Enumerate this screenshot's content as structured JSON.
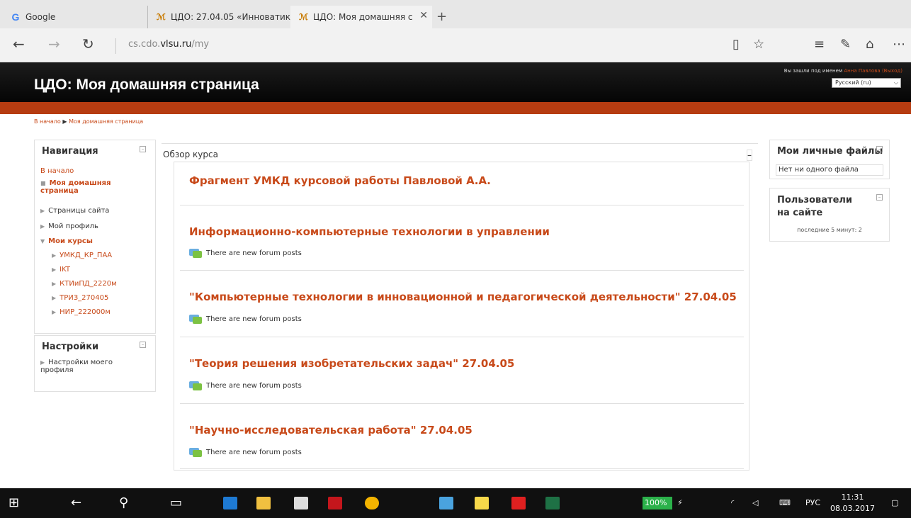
{
  "browser": {
    "tabs": [
      {
        "label": "Google"
      },
      {
        "label": "ЦДО: 27.04.05 «Инноватик"
      },
      {
        "label": "ЦДО: Моя домашняя с"
      }
    ],
    "url_prefix": "cs.cdo.",
    "url_domain": "vlsu.ru",
    "url_path": "/my"
  },
  "header": {
    "site_title": "ЦДО: Моя домашняя страница",
    "login_prefix": "Вы зашли под именем ",
    "user_name": "Анна Павлова",
    "logout": "(Выход)",
    "language": "Русский (ru)"
  },
  "breadcrumb": {
    "home": "В начало",
    "separator": "▶",
    "current": "Моя домашняя страница"
  },
  "navigation": {
    "title": "Навигация",
    "home": "В начало",
    "items": [
      {
        "label": "Моя домашняя страница"
      },
      {
        "label": "Страницы сайта"
      },
      {
        "label": "Мой профиль"
      },
      {
        "label": "Мои курсы"
      }
    ],
    "courses": [
      "УМКД_КР_ПАА",
      "IKT",
      "КТИиПД_2220м",
      "ТРИЗ_270405",
      "НИР_222000м"
    ]
  },
  "settings": {
    "title": "Настройки",
    "item": "Настройки моего профиля"
  },
  "overview": {
    "title": "Обзор курса",
    "courses": [
      {
        "title": "Фрагмент УМКД курсовой работы Павловой А.А.",
        "notice": ""
      },
      {
        "title": "Информационно-компьютерные технологии в управлении",
        "notice": "There are new forum posts"
      },
      {
        "title": "\"Компьютерные технологии в инновационной и педагогической деятельности\" 27.04.05",
        "notice": "There are new forum posts"
      },
      {
        "title": "\"Теория решения изобретательских задач\" 27.04.05",
        "notice": "There are new forum posts"
      },
      {
        "title": "\"Научно-исследовательская работа\" 27.04.05",
        "notice": "There are new forum posts"
      }
    ]
  },
  "private_files": {
    "title": "Мои личные файлы",
    "empty": "Нет ни одного файла"
  },
  "online_users": {
    "title": "Пользователи на сайте",
    "status": "последние 5 минут: 2"
  },
  "taskbar": {
    "battery": "100%",
    "language": "РУС",
    "time": "11:31",
    "date": "08.03.2017"
  },
  "colors": {
    "accent": "#c84a1a",
    "bar": "#b63c11",
    "header": "#111111"
  }
}
